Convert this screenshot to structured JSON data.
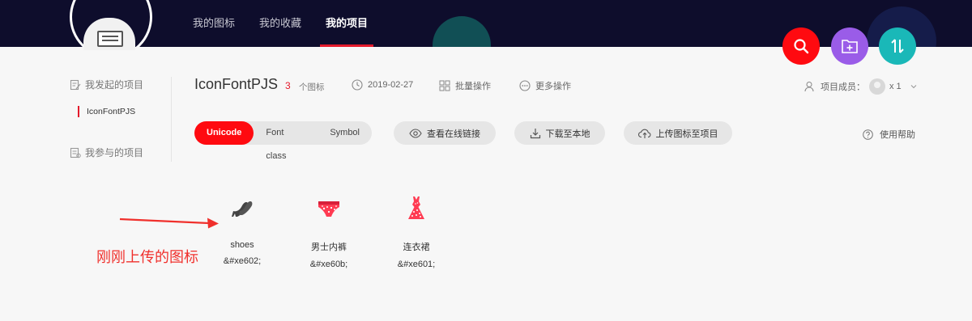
{
  "nav": {
    "items": [
      {
        "label": "我的图标",
        "active": false
      },
      {
        "label": "我的收藏",
        "active": false
      },
      {
        "label": "我的项目",
        "active": true
      }
    ]
  },
  "fabs": [
    {
      "name": "search",
      "color": "#ff0a10"
    },
    {
      "name": "add-project",
      "color": "#9a5ce8"
    },
    {
      "name": "sort",
      "color": "#1ab8b8"
    }
  ],
  "sidebar": {
    "created_label": "我发起的项目",
    "projects": [
      "IconFontPJS"
    ],
    "joined_label": "我参与的项目"
  },
  "project": {
    "title": "IconFontPJS",
    "icon_count": "3",
    "icon_count_label": "个图标",
    "date": "2019-02-27",
    "batch_label": "批量操作",
    "more_label": "更多操作",
    "members_label": "项目成员：",
    "members_count": "x 1"
  },
  "tabs": {
    "items": [
      "Unicode",
      "Font class",
      "Symbol"
    ],
    "active": "Unicode"
  },
  "actions": {
    "view_link": "查看在线链接",
    "download": "下载至本地",
    "upload": "上传图标至项目",
    "help": "使用帮助"
  },
  "icons": [
    {
      "name": "shoes",
      "code": "&#xe602;",
      "icon": "high-heel-shoes-icon"
    },
    {
      "name": "男士内裤",
      "code": "&#xe60b;",
      "icon": "briefs-icon"
    },
    {
      "name": "连衣裙",
      "code": "&#xe601;",
      "icon": "dress-icon"
    }
  ],
  "annotation": "刚刚上传的图标",
  "colors": {
    "topbar": "#0e0d2c",
    "accent": "#ff0a10",
    "purple": "#9a5ce8",
    "teal": "#1ab8b8"
  }
}
